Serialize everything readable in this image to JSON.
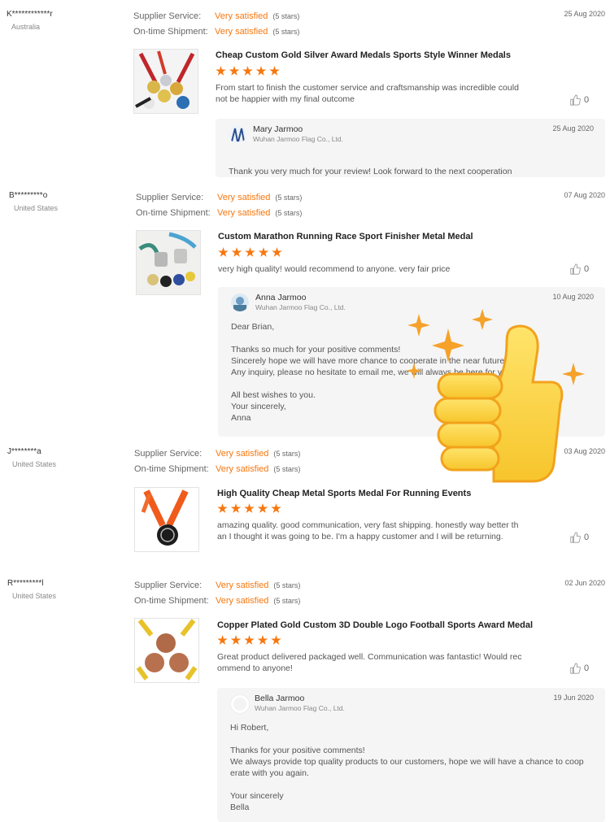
{
  "labels": {
    "supplier_service": "Supplier Service:",
    "ontime_shipment": "On-time Shipment:",
    "very_satisfied": "Very satisfied",
    "five_stars": "(5 stars)"
  },
  "colors": {
    "accent": "#f7770f",
    "reply_bg": "#f5f5f5"
  },
  "reviews": [
    {
      "buyer": "K************r",
      "country": "Australia",
      "date": "25 Aug 2020",
      "product_title": "Cheap Custom Gold Silver Award Medals Sports Style Winner Medals",
      "rating": 5,
      "comment": "From start to finish the customer service and craftsmanship was incredible could\nnot be happier with my final outcome",
      "likes": "0",
      "reply": {
        "name": "Mary Jarmoo",
        "company": "Wuhan Jarmoo Flag Co., Ltd.",
        "date": "25 Aug 2020",
        "text": "Thank you very much for your review! Look forward to the next cooperation"
      }
    },
    {
      "buyer": "B*********o",
      "country": "United States",
      "date": "07 Aug 2020",
      "product_title": "Custom Marathon Running Race Sport Finisher Metal Medal",
      "rating": 5,
      "comment": "very high quality! would recommend to anyone. very fair price",
      "likes": "0",
      "reply": {
        "name": "Anna Jarmoo",
        "company": "Wuhan Jarmoo Flag Co., Ltd.",
        "date": "10 Aug 2020",
        "text": "Dear Brian,\n\nThanks so much for your positive comments!\nSincerely hope we will have more chance to cooperate in the near future\nAny inquiry, please no hesitate to email me, we will always be here for you !\n\nAll best wishes to you.\nYour sincerely,\nAnna"
      }
    },
    {
      "buyer": "J********a",
      "country": "United States",
      "date": "03 Aug 2020",
      "product_title": "High Quality Cheap Metal Sports Medal For Running Events",
      "rating": 5,
      "comment": "amazing quality. good communication, very fast shipping.  honestly way better th\nan I thought it was going to be. I'm a happy customer and I will be returning.",
      "likes": "0"
    },
    {
      "buyer": "R*********l",
      "country": "United States",
      "date": "02 Jun 2020",
      "product_title": "Copper Plated Gold Custom 3D Double Logo Football Sports Award Medal",
      "rating": 5,
      "comment": "Great product delivered packaged well.  Communication was fantastic!  Would rec\nommend to anyone!",
      "likes": "0",
      "reply": {
        "name": "Bella Jarmoo",
        "company": "Wuhan Jarmoo Flag Co., Ltd.",
        "date": "19 Jun 2020",
        "text": "Hi Robert,\n\nThanks for your positive comments!\nWe always provide top quality products to our customers, hope we will have a chance to coop\nerate with you again.\n\nYour sincerely\nBella"
      }
    }
  ],
  "overlay_icon": "thumbs-up-sparkle-icon"
}
